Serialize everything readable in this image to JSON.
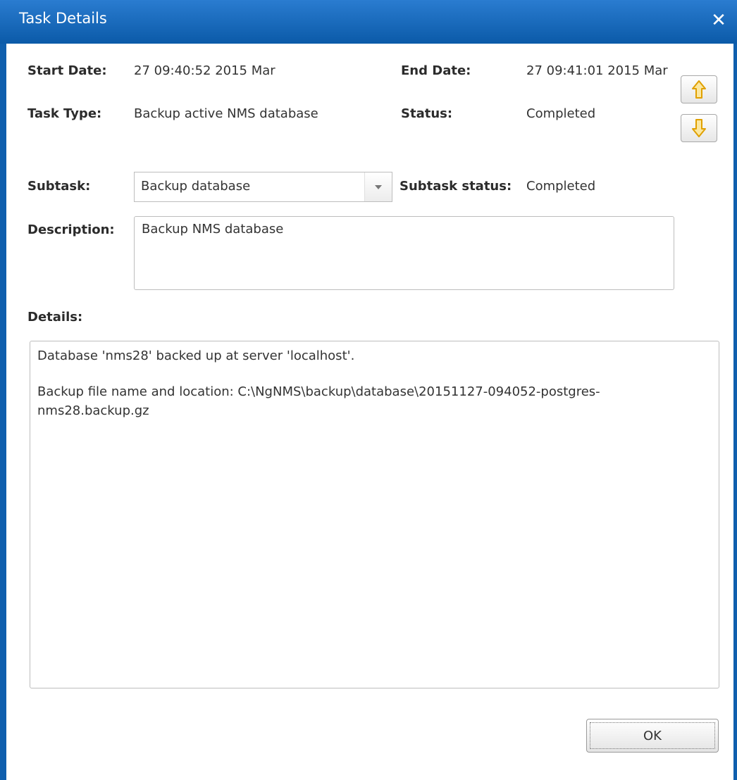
{
  "window": {
    "title": "Task Details",
    "close_label": "✕"
  },
  "info": {
    "start_date_label": "Start Date:",
    "start_date_value": "27 09:40:52 2015 Mar",
    "end_date_label": "End Date:",
    "end_date_value": "27 09:41:01 2015 Mar",
    "task_type_label": "Task Type:",
    "task_type_value": "Backup active NMS database",
    "status_label": "Status:",
    "status_value": "Completed"
  },
  "subtask": {
    "label": "Subtask:",
    "selected": "Backup database",
    "status_label": "Subtask status:",
    "status_value": "Completed"
  },
  "description": {
    "label": "Description:",
    "value": "Backup NMS database"
  },
  "details": {
    "label": "Details:",
    "line1": "Database 'nms28' backed up at server 'localhost'.",
    "line2": "Backup file name and location: C:\\NgNMS\\backup\\database\\20151127-094052-postgres-",
    "line3": "nms28.backup.gz"
  },
  "buttons": {
    "ok_label": "OK"
  },
  "colors": {
    "titlebar": "#0f5fae",
    "arrow_icon": "#f2b705"
  }
}
